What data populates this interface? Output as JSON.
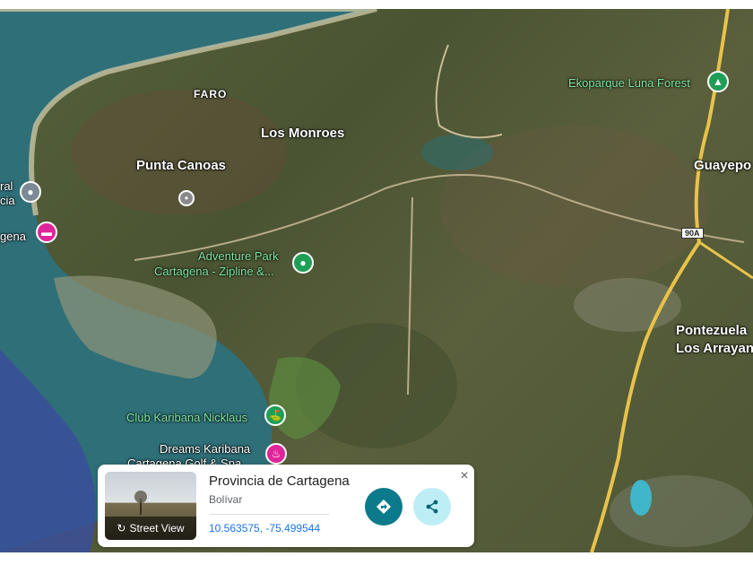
{
  "map": {
    "labels": {
      "faro": "FARO",
      "los_monroes": "Los Monroes",
      "punta_canoas": "Punta Canoas",
      "ral": "ral",
      "cia": "cia",
      "gena": "gena",
      "adventure_park_1": "Adventure Park",
      "adventure_park_2": "Cartagena -  Zipline &...",
      "ekoparque": "Ekoparque Luna Forest",
      "guayepo": "Guayepo",
      "pontezuela_1": "Pontezuela",
      "pontezuela_2": "Los Arrayan",
      "club_karibana": "Club Karibana Nicklaus",
      "dreams_1": "Dreams Karibana",
      "dreams_2": "Cartagena Golf & Spa",
      "road_shield": "90A"
    },
    "colors": {
      "sea": "#2f6f78",
      "land": "#4f5a37",
      "road": "#e8c34a",
      "green_pin": "#1f9e57",
      "magenta_pin": "#e0249a"
    }
  },
  "card": {
    "title": "Provincia de Cartagena",
    "subtitle": "Bolívar",
    "coordinates": "10.563575, -75.499544",
    "street_view_label": "Street View",
    "close_label": "×"
  }
}
